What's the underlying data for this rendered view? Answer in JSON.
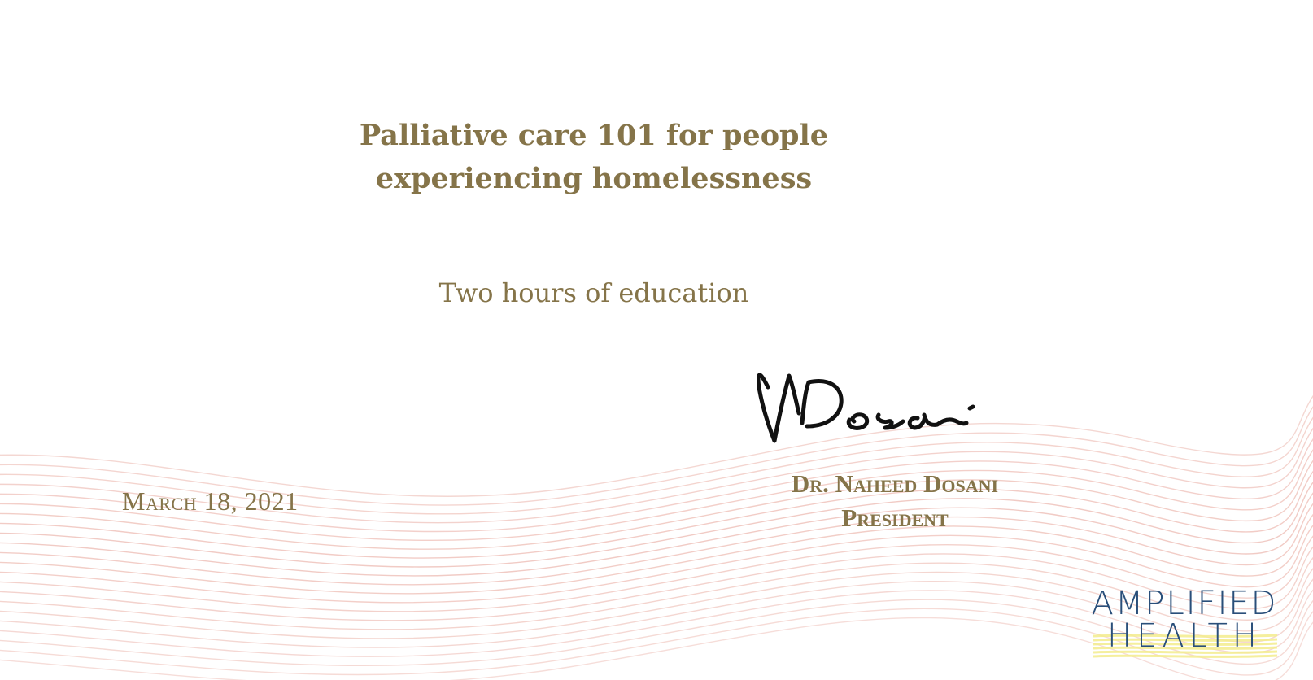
{
  "certificate": {
    "course_title_line1": "Palliative care 101 for people",
    "course_title_line2": "experiencing homelessness",
    "credit": "Two hours of education",
    "date": "March 18, 2021",
    "signer": {
      "name": "Dr. Naheed Dosani",
      "role": "President",
      "signature_text": "NDosani"
    }
  },
  "logo": {
    "line1": "AMPLIFIED",
    "line2": "HEALTH"
  },
  "colors": {
    "accent": "#857449",
    "brand": "#2a4f7a",
    "wave": "#e8a79c",
    "logo_band": "#f3ec8c"
  }
}
